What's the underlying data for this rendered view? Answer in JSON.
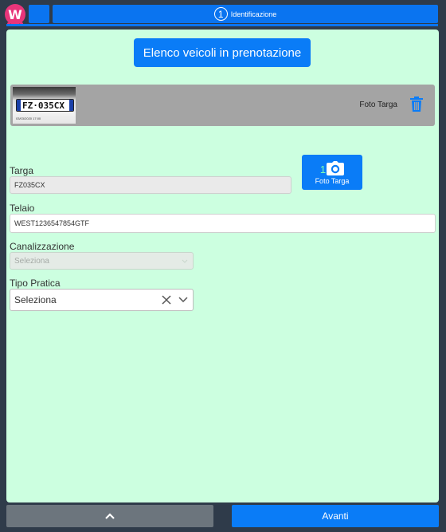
{
  "header": {
    "logo_letter": "W",
    "step_number": "1",
    "step_label": "Identificazione"
  },
  "main": {
    "list_button_label": "Elenco veicoli in prenotazione",
    "photo": {
      "plate_text": "FZ·035CX",
      "stamp_text": "03/03/2020 17:00",
      "label": "Foto Targa"
    },
    "targa": {
      "label": "Targa",
      "value": "FZ035CX"
    },
    "camera": {
      "count": "1",
      "label": "Foto Targa"
    },
    "telaio": {
      "label": "Telaio",
      "value": "WEST1236547854GTF"
    },
    "canalizzazione": {
      "label": "Canalizzazione",
      "placeholder": "Seleziona"
    },
    "tipo_pratica": {
      "label": "Tipo Pratica",
      "value": "Seleziona"
    }
  },
  "footer": {
    "next_label": "Avanti"
  },
  "colors": {
    "primary": "#0a7cf7",
    "panel": "#ccffe0",
    "frame": "#2f3b4a",
    "logo": "#e8357a",
    "secondary_button": "#6c757d"
  },
  "icons": [
    "logo-icon",
    "trash-icon",
    "camera-icon",
    "clear-icon",
    "chevron-down-icon",
    "chevron-up-icon"
  ]
}
